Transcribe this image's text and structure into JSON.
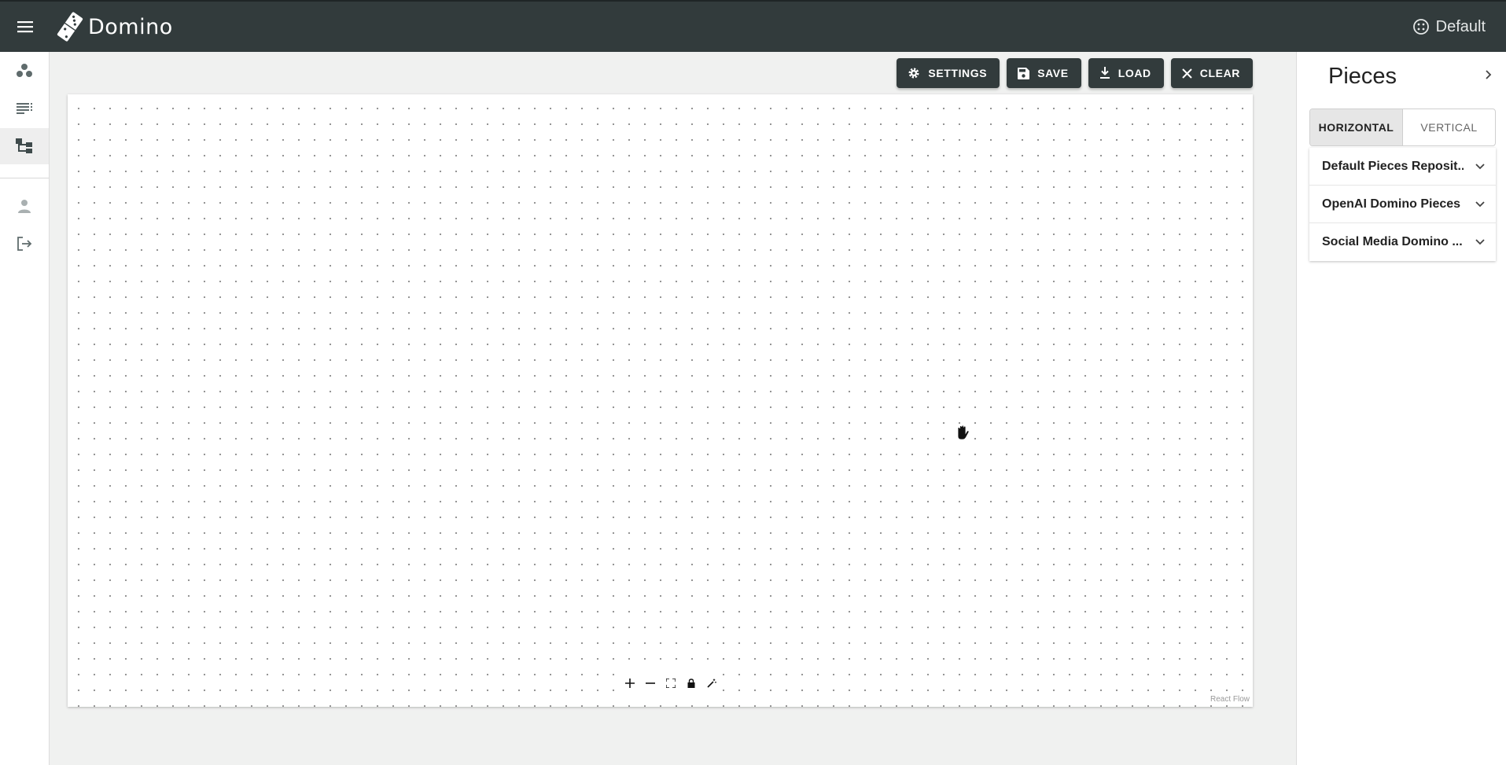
{
  "app": {
    "name": "Domino",
    "workspace_label": "Default"
  },
  "nav": {
    "items": [
      {
        "icon": "workspaces-icon"
      },
      {
        "icon": "list-icon"
      },
      {
        "icon": "workflow-editor-icon",
        "active": true
      },
      {
        "icon": "person-icon"
      },
      {
        "icon": "logout-icon"
      }
    ]
  },
  "toolbar": {
    "settings_label": "SETTINGS",
    "save_label": "SAVE",
    "load_label": "LOAD",
    "clear_label": "CLEAR"
  },
  "canvas": {
    "attribution": "React Flow",
    "controls": [
      "zoom-in",
      "zoom-out",
      "fit-view",
      "lock",
      "magic-wand"
    ]
  },
  "pieces_panel": {
    "title": "Pieces",
    "orientation_options": [
      "HORIZONTAL",
      "VERTICAL"
    ],
    "selected_orientation": "HORIZONTAL",
    "repositories": [
      {
        "label": "Default Pieces Reposit..."
      },
      {
        "label": "OpenAI Domino Pieces"
      },
      {
        "label": "Social Media Domino ..."
      }
    ]
  },
  "colors": {
    "appbar": "#323b3c",
    "button": "#323b3c",
    "background": "#f0f1f0"
  }
}
